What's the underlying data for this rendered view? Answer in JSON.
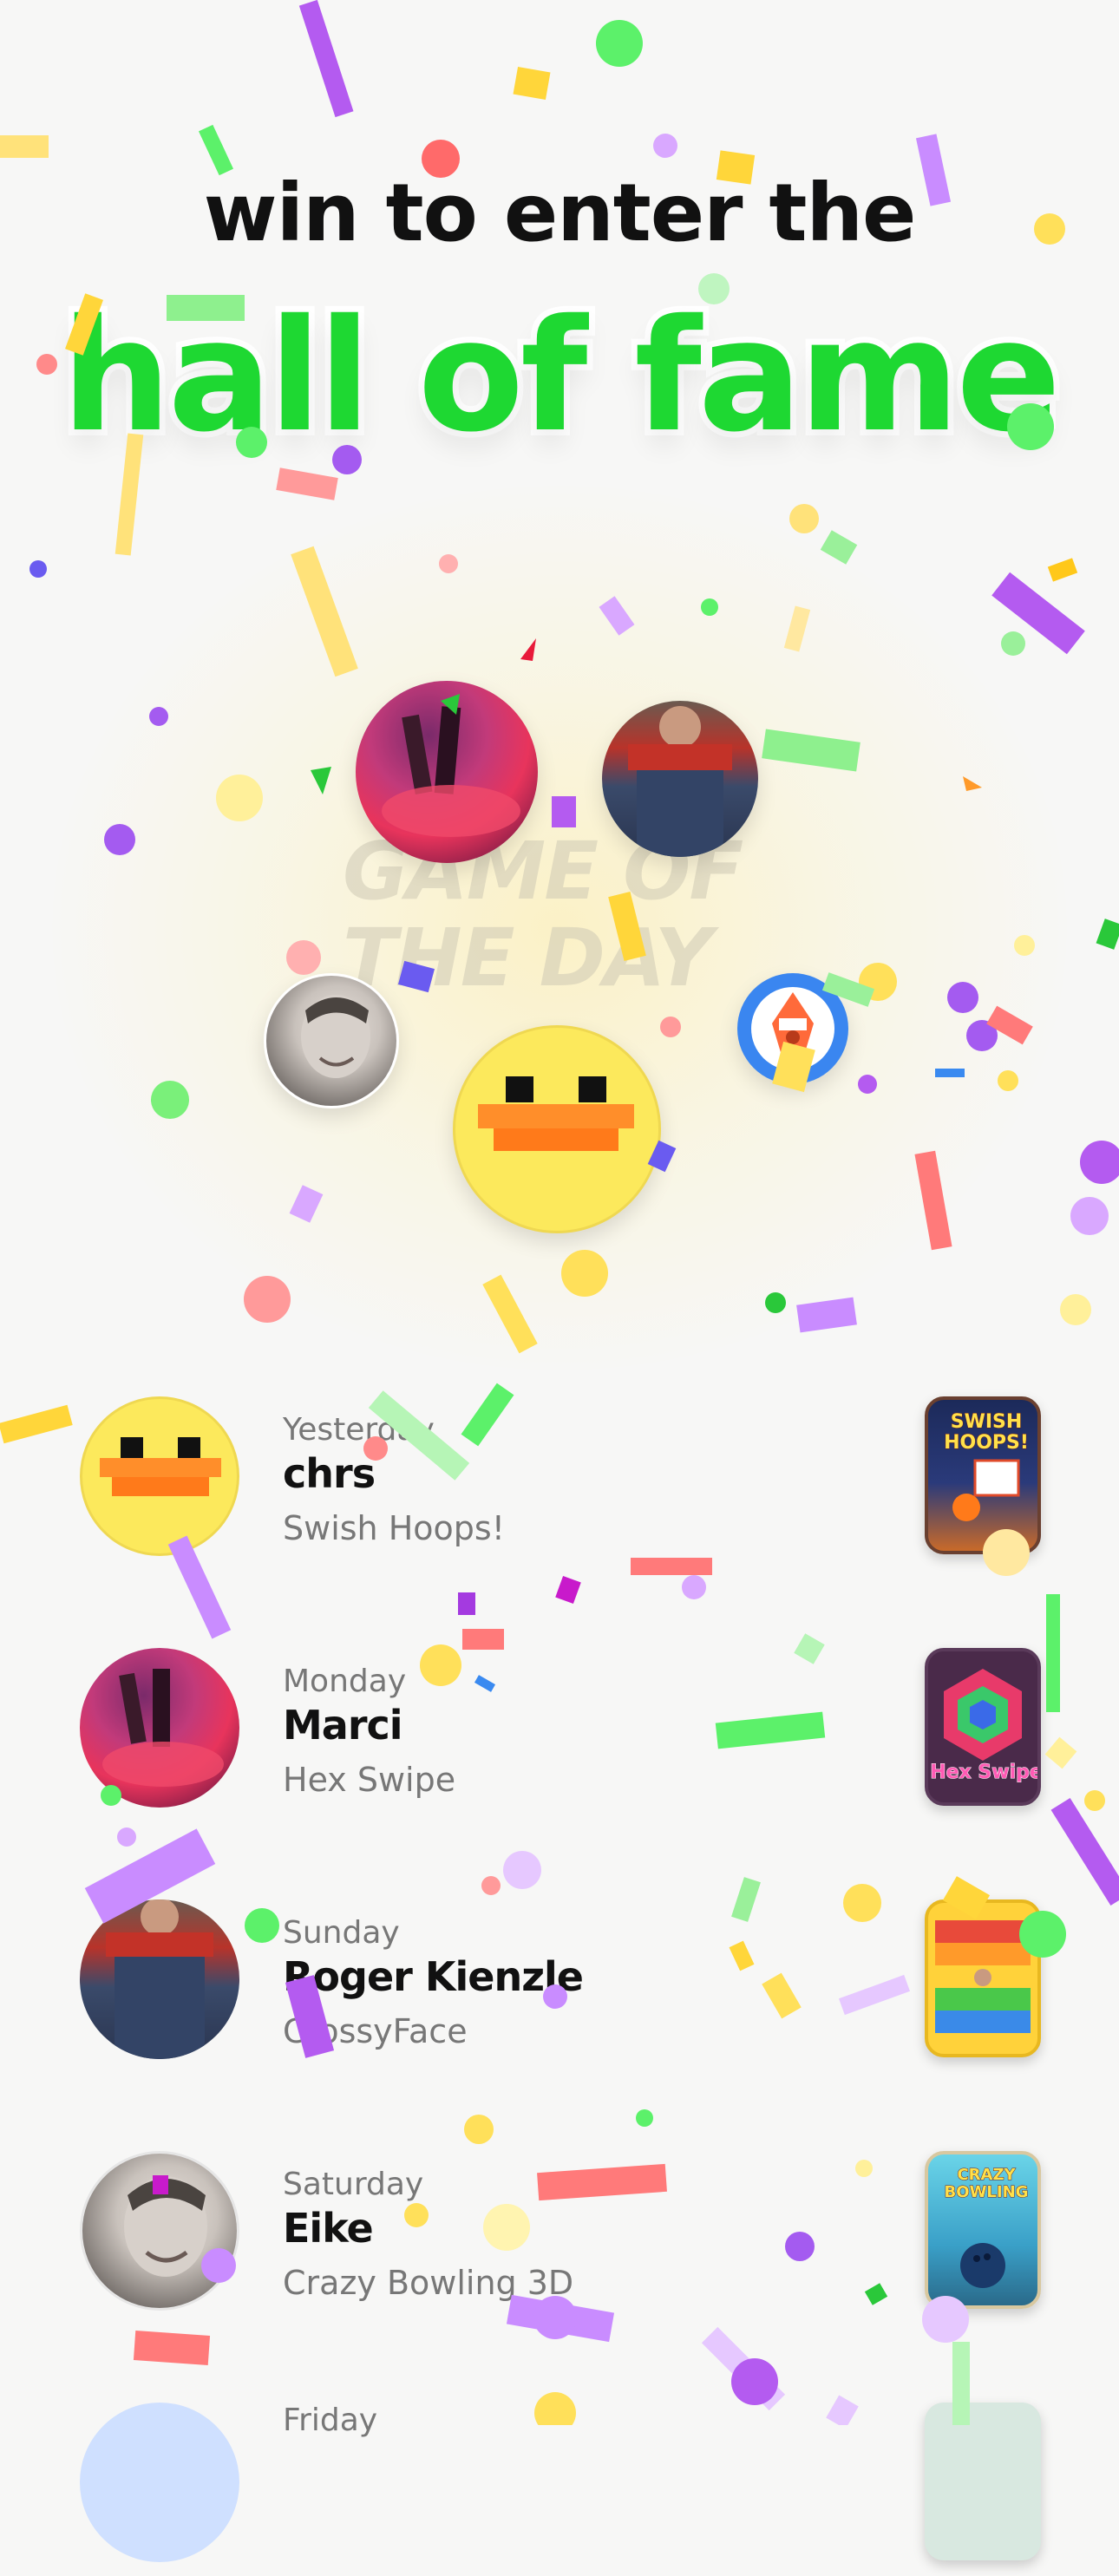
{
  "header": {
    "line1": "win to enter the",
    "line2": "hall of fame"
  },
  "podium": {
    "watermark_line1": "GAME OF",
    "watermark_line2": "THE DAY"
  },
  "entries": [
    {
      "day": "Yesterday",
      "name": "chrs",
      "game": "Swish Hoops!",
      "thumb_label": "SWISH HOOPS!"
    },
    {
      "day": "Monday",
      "name": "Marci",
      "game": "Hex Swipe",
      "thumb_label": "Hex Swipe"
    },
    {
      "day": "Sunday",
      "name": "Roger Kienzle",
      "game": "CrossyFace",
      "thumb_label": ""
    },
    {
      "day": "Saturday",
      "name": "Eike",
      "game": "Crazy Bowling 3D",
      "thumb_label": "CRAZY BOWLING"
    },
    {
      "day": "Friday",
      "name": "",
      "game": "",
      "thumb_label": ""
    }
  ],
  "colors": {
    "accent_green": "#1ed832",
    "duck_yellow": "#fce95c",
    "duck_bill": "#ff8e2a",
    "background": "#f7f7f6"
  }
}
